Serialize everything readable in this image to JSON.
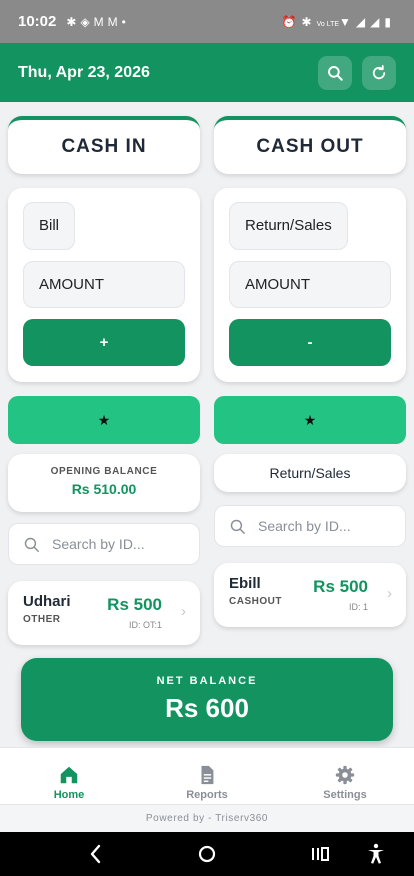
{
  "status_bar": {
    "time": "10:02",
    "left_icons": [
      "bluetooth-icon",
      "app-icon",
      "gmail-icon",
      "gmail-icon",
      "dot-icon"
    ],
    "right_icons": [
      "alarm-icon",
      "bluetooth-icon",
      "volte-icon",
      "wifi-icon",
      "signal-icon",
      "signal-icon",
      "battery-icon"
    ],
    "volte_text": "Vo LTE"
  },
  "app_bar": {
    "date": "Thu, Apr 23, 2026",
    "search_icon": "search-icon",
    "refresh_icon": "refresh-icon"
  },
  "cash_in": {
    "header": "CASH IN",
    "category": "Bill",
    "amount_placeholder": "AMOUNT",
    "action_label": "+",
    "star_label": "★",
    "opening_balance_label": "OPENING BALANCE",
    "opening_balance_value": "Rs 510.00",
    "search_placeholder": "Search by ID...",
    "transactions": [
      {
        "name": "Udhari",
        "type": "OTHER",
        "amount": "Rs 500",
        "id": "ID: OT:1"
      }
    ]
  },
  "cash_out": {
    "header": "CASH OUT",
    "category": "Return/Sales",
    "amount_placeholder": "AMOUNT",
    "action_label": "-",
    "star_label": "★",
    "category_display": "Return/Sales",
    "search_placeholder": "Search by ID...",
    "transactions": [
      {
        "name": "Ebill",
        "type": "CASHOUT",
        "amount": "Rs 500",
        "id": "ID: 1"
      }
    ]
  },
  "net_balance": {
    "label": "NET BALANCE",
    "value": "Rs 600"
  },
  "bottom_nav": {
    "items": [
      {
        "label": "Home",
        "icon": "home-icon",
        "active": true
      },
      {
        "label": "Reports",
        "icon": "reports-icon",
        "active": false
      },
      {
        "label": "Settings",
        "icon": "settings-icon",
        "active": false
      }
    ]
  },
  "footer": {
    "powered_by": "Powered by - Triserv360"
  },
  "colors": {
    "primary": "#12935f",
    "accent_bright": "#22c383",
    "status_bar": "#8a8a8a",
    "background": "#f0f1f3"
  }
}
